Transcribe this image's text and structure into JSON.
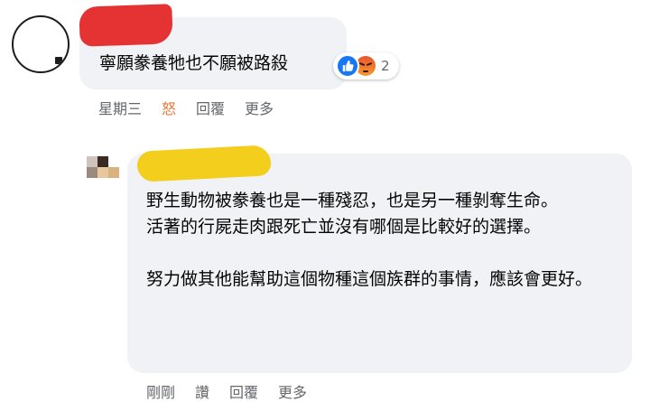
{
  "comment": {
    "text": "寧願豢養牠也不願被路殺",
    "reactions": {
      "icons": [
        "like-icon",
        "angry-icon"
      ],
      "count": "2",
      "colors": {
        "like": "#1877f2",
        "angry": "#e9542c"
      }
    },
    "actions": {
      "time": "星期三",
      "reaction": "怒",
      "reply": "回覆",
      "more": "更多"
    }
  },
  "reply": {
    "paragraphs": [
      "野生動物被豢養也是一種殘忍，也是另一種剝奪生命。",
      "活著的行屍走肉跟死亡並沒有哪個是比較好的選擇。",
      "努力做其他能幫助這個物種這個族群的事情，應該會更好。"
    ],
    "actions": {
      "time": "剛剛",
      "like": "讚",
      "reply": "回覆",
      "more": "更多"
    }
  },
  "theme": {
    "bubble": "#f0f2f5",
    "meta_text": "#65676b",
    "redaction_red": "#e53333",
    "redaction_yellow": "#f4ce1c"
  }
}
